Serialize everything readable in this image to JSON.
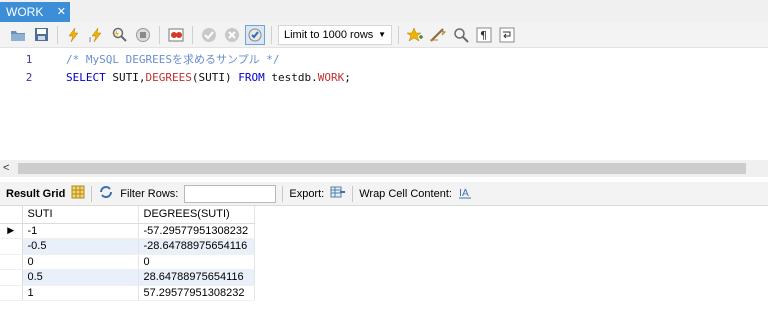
{
  "tab": {
    "title": "WORK",
    "close": "✕"
  },
  "toolbar": {
    "limit_select": "Limit to 1000 rows",
    "icons": [
      "folder-open-icon",
      "save-icon",
      "execute-icon",
      "execute-current-icon",
      "explain-icon",
      "stop-icon",
      "toggle-error-icon",
      "commit-icon",
      "rollback-icon",
      "autocommit-icon",
      "bookmark-icon",
      "beautify-icon",
      "find-icon",
      "invisible-chars-icon",
      "wrap-icon"
    ]
  },
  "editor": {
    "lines": [
      {
        "num": "1",
        "comment": "/* MySQL DEGREESを求めるサンプル */"
      },
      {
        "num": "2",
        "kw1": "SELECT",
        "ident1": " SUTI,",
        "fn": "DEGREES",
        "ident2": "(SUTI) ",
        "kw2": "FROM",
        "ident3": " testdb.",
        "kw3": "WORK",
        "ident4": ";"
      }
    ]
  },
  "scrollbar": {
    "left_arrow": "<"
  },
  "result_toolbar": {
    "result_grid": "Result Grid",
    "filter_rows": "Filter Rows:",
    "export": "Export:",
    "wrap_cell": "Wrap Cell Content:"
  },
  "grid": {
    "columns": [
      "SUTI",
      "DEGREES(SUTI)"
    ],
    "rows": [
      [
        "-1",
        "-57.29577951308232"
      ],
      [
        "-0.5",
        "-28.64788975654116"
      ],
      [
        "0",
        "0"
      ],
      [
        "0.5",
        "28.64788975654116"
      ],
      [
        "1",
        "57.29577951308232"
      ]
    ],
    "row_marker": "▶"
  }
}
